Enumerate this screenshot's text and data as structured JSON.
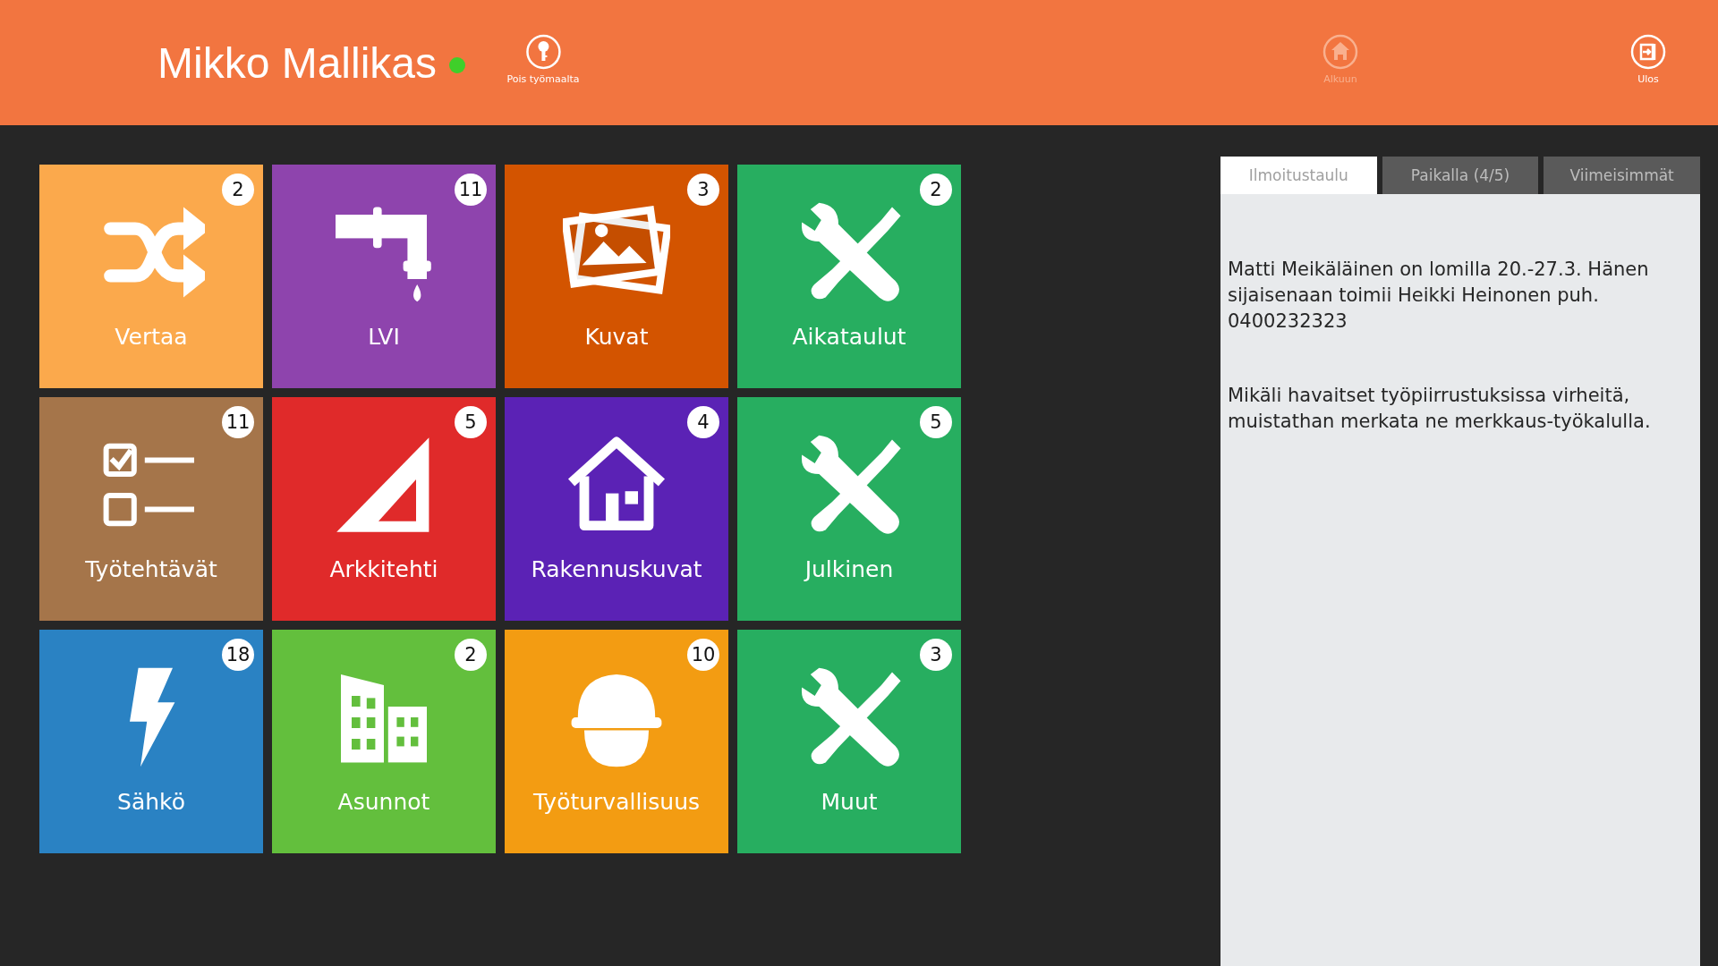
{
  "header": {
    "user_name": "Mikko Mallikas",
    "online": true,
    "actions": [
      {
        "label": "Pois työmaalta",
        "kind": "key",
        "disabled": false
      },
      {
        "label": "Alkuun",
        "kind": "home",
        "disabled": true
      },
      {
        "label": "Ulos",
        "kind": "exit",
        "disabled": false
      }
    ]
  },
  "tiles": [
    {
      "label": "Vertaa",
      "count": "2",
      "kind": "shuffle",
      "color": "#fba94c"
    },
    {
      "label": "LVI",
      "count": "11",
      "kind": "tap",
      "color": "#8e44ad"
    },
    {
      "label": "Kuvat",
      "count": "3",
      "kind": "photos",
      "color": "#d35400"
    },
    {
      "label": "Aikataulut",
      "count": "2",
      "kind": "tools",
      "color": "#27ae60"
    },
    {
      "label": "Työtehtävät",
      "count": "11",
      "kind": "checklist",
      "color": "#a5754a"
    },
    {
      "label": "Arkkitehti",
      "count": "5",
      "kind": "ruler",
      "color": "#e02a2a"
    },
    {
      "label": "Rakennuskuvat",
      "count": "4",
      "kind": "house",
      "color": "#5b22b5"
    },
    {
      "label": "Julkinen",
      "count": "5",
      "kind": "tools",
      "color": "#27ae60"
    },
    {
      "label": "Sähkö",
      "count": "18",
      "kind": "bolt",
      "color": "#2a82c3"
    },
    {
      "label": "Asunnot",
      "count": "2",
      "kind": "building",
      "color": "#63bf3d"
    },
    {
      "label": "Työturvallisuus",
      "count": "10",
      "kind": "helmet",
      "color": "#f39c12"
    },
    {
      "label": "Muut",
      "count": "3",
      "kind": "tools",
      "color": "#27ae60"
    }
  ],
  "panel": {
    "tabs": [
      {
        "label": "Ilmoitustaulu",
        "selected": true
      },
      {
        "label": "Paikalla (4/5)",
        "selected": false
      },
      {
        "label": "Viimeisimmät",
        "selected": false
      }
    ],
    "messages": [
      "Matti Meikäläinen on lomilla 20.-27.3. Hänen sijaisenaan toimii Heikki Heinonen puh. 0400232323",
      "Mikäli havaitset työpiirrustuksissa virheitä, muistathan merkata ne merkkaus-työkalulla."
    ]
  }
}
